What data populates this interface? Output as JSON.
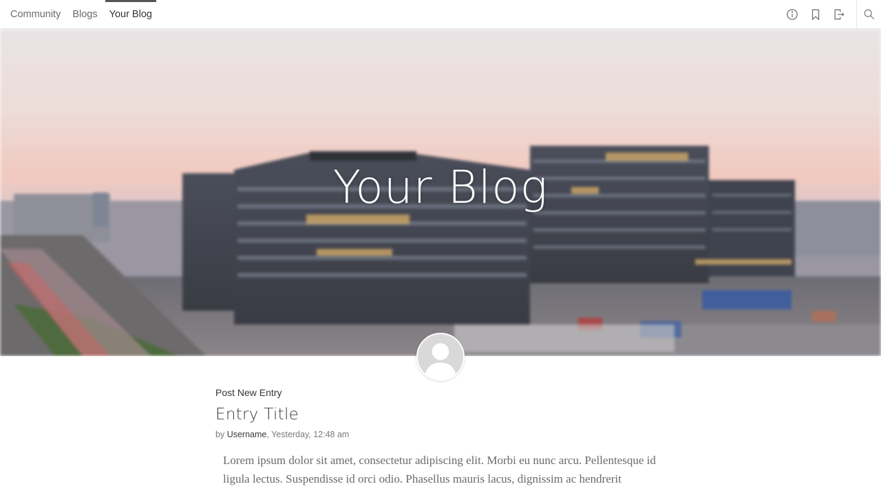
{
  "nav": {
    "tabs": [
      {
        "label": "Community",
        "active": false
      },
      {
        "label": "Blogs",
        "active": false
      },
      {
        "label": "Your Blog",
        "active": true
      }
    ],
    "icons": [
      "info-icon",
      "bookmark-icon",
      "logout-icon",
      "search-icon"
    ]
  },
  "hero": {
    "title": "Your Blog"
  },
  "actions": {
    "post_new": "Post New Entry"
  },
  "entry": {
    "title": "Entry Title",
    "by_prefix": "by",
    "author": "Username",
    "date": ", Yesterday, 12:48 am",
    "body": "Lorem ipsum dolor sit amet, consectetur adipiscing elit. Morbi eu nunc arcu. Pellentesque id ligula lectus. Suspendisse id orci odio. Phasellus mauris lacus, dignissim ac hendrerit"
  },
  "colors": {
    "accent": "#555555",
    "text": "#444444",
    "muted": "#7a7a7a"
  }
}
